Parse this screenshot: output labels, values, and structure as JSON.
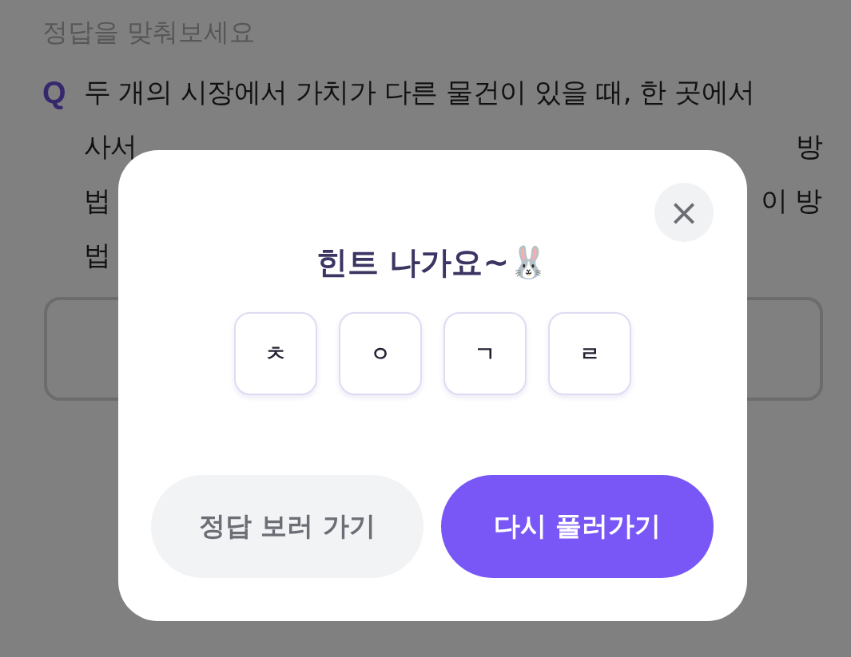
{
  "page": {
    "title": "정답을 맞춰보세요"
  },
  "question": {
    "marker": "Q",
    "lines": [
      {
        "parts": [
          "두 개의 시장에서 가치가 다른 물건이 있을 때, 한 곳에서"
        ]
      },
      {
        "parts": [
          "사서",
          "방"
        ]
      },
      {
        "parts": [
          "법",
          "이 방"
        ]
      },
      {
        "parts": [
          "법"
        ]
      }
    ]
  },
  "hint_modal": {
    "close": "×",
    "title": "힌트 나가요~🐰",
    "letters": [
      "ㅊ",
      "ㅇ",
      "ㄱ",
      "ㄹ"
    ],
    "buttons": [
      {
        "label": "정답 보러 가기",
        "kind": "secondary"
      },
      {
        "label": "다시 풀러가기",
        "kind": "primary"
      }
    ]
  }
}
